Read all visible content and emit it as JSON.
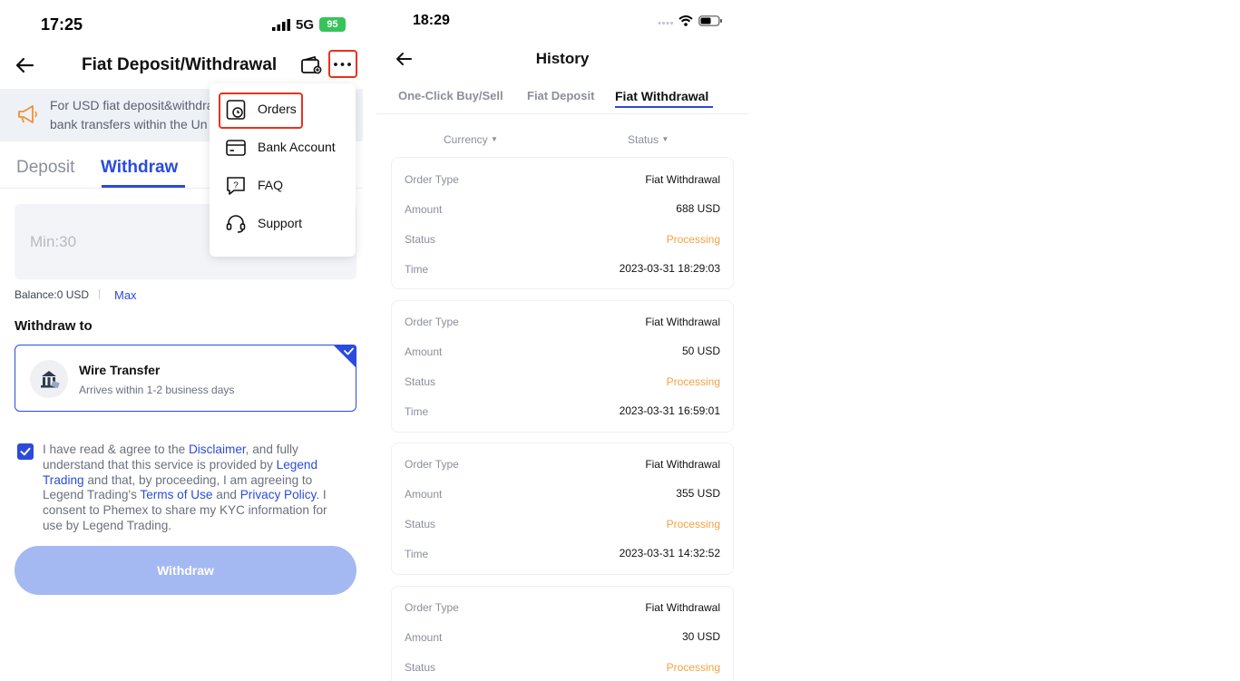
{
  "left": {
    "status_bar": {
      "time": "17:25",
      "network": "5G",
      "battery": "95"
    },
    "header": {
      "title": "Fiat Deposit/Withdrawal",
      "back_icon": "arrow-left-icon",
      "wallet_icon": "wallet-icon",
      "more_icon": "more-dots-icon"
    },
    "banner": {
      "line1": "For USD fiat deposit&withdra",
      "line2": "bank transfers within the Un"
    },
    "tabs": [
      {
        "label": "Deposit"
      },
      {
        "label": "Withdraw",
        "active": true
      }
    ],
    "amount_placeholder": "Min:30",
    "balance_label": "Balance:0 USD",
    "max_label": "Max",
    "withdraw_to_title": "Withdraw to",
    "method": {
      "title": "Wire Transfer",
      "subtitle": "Arrives within 1-2 business days"
    },
    "agreement": {
      "p1": "I have read & agree to the ",
      "disclaimer": "Disclaimer",
      "p2": ", and fully understand that this service is provided by ",
      "legend": "Legend Trading",
      "p3": " and that, by proceeding, I am agreeing to Legend Trading's ",
      "terms": "Terms of Use",
      "p4": " and ",
      "privacy": "Privacy Policy",
      "p5": ". I consent to Phemex to share my KYC information for use by Legend Trading."
    },
    "withdraw_button": "Withdraw",
    "menu": [
      {
        "label": "Orders",
        "icon": "orders-icon",
        "highlighted": true
      },
      {
        "label": "Bank Account",
        "icon": "bank-card-icon"
      },
      {
        "label": "FAQ",
        "icon": "faq-icon"
      },
      {
        "label": "Support",
        "icon": "headset-icon"
      }
    ],
    "colors": {
      "accent": "#2a4bdc",
      "highlight": "#e8321c",
      "button_disabled": "#a4b8f2",
      "banner_icon": "#f0903a"
    }
  },
  "right": {
    "status_bar": {
      "time": "18:29"
    },
    "header": {
      "title": "History",
      "back_icon": "arrow-left-icon"
    },
    "tabs": [
      {
        "label": "One-Click Buy/Sell"
      },
      {
        "label": "Fiat Deposit"
      },
      {
        "label": "Fiat Withdrawal",
        "active": true
      }
    ],
    "filters": {
      "currency": "Currency",
      "status": "Status"
    },
    "field_labels": {
      "type": "Order Type",
      "amount": "Amount",
      "status": "Status",
      "time": "Time"
    },
    "orders": [
      {
        "type": "Fiat Withdrawal",
        "amount": "688 USD",
        "status": "Processing",
        "time": "2023-03-31 18:29:03"
      },
      {
        "type": "Fiat Withdrawal",
        "amount": "50 USD",
        "status": "Processing",
        "time": "2023-03-31 16:59:01"
      },
      {
        "type": "Fiat Withdrawal",
        "amount": "355 USD",
        "status": "Processing",
        "time": "2023-03-31 14:32:52"
      },
      {
        "type": "Fiat Withdrawal",
        "amount": "30 USD",
        "status": "Processing",
        "time": ""
      }
    ],
    "colors": {
      "processing": "#f5a140"
    }
  }
}
